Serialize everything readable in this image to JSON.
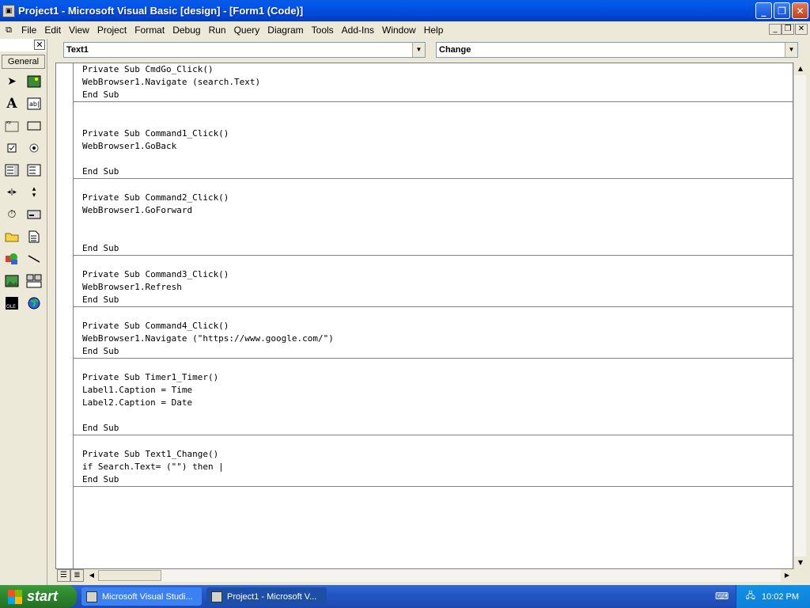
{
  "window": {
    "title": "Project1 - Microsoft Visual Basic [design] - [Form1 (Code)]"
  },
  "menu": [
    "File",
    "Edit",
    "View",
    "Project",
    "Format",
    "Debug",
    "Run",
    "Query",
    "Diagram",
    "Tools",
    "Add-Ins",
    "Window",
    "Help"
  ],
  "toolbox": {
    "tab_label": "General",
    "tools": [
      "pointer-icon",
      "picturebox-icon",
      "label-icon",
      "textbox-icon",
      "frame-icon",
      "commandbutton-icon",
      "checkbox-icon",
      "optionbutton-icon",
      "combobox-icon",
      "listbox-icon",
      "hscrollbar-icon",
      "vscrollbar-icon",
      "timer-icon",
      "drivelistbox-icon",
      "dirlistbox-icon",
      "filelistbox-icon",
      "shape-icon",
      "line-icon",
      "image-icon",
      "data-icon",
      "ole-icon",
      "webbrowser-icon"
    ]
  },
  "code_window": {
    "object_combo": "Text1",
    "procedure_combo": "Change",
    "procedures": [
      {
        "lines": [
          "Private Sub CmdGo_Click()",
          "WebBrowser1.Navigate (search.Text)",
          "End Sub"
        ]
      },
      {
        "lines": [
          "",
          "",
          "Private Sub Command1_Click()",
          "WebBrowser1.GoBack",
          "",
          "End Sub"
        ]
      },
      {
        "lines": [
          "",
          "Private Sub Command2_Click()",
          "WebBrowser1.GoForward",
          "",
          "",
          "End Sub"
        ]
      },
      {
        "lines": [
          "",
          "Private Sub Command3_Click()",
          "WebBrowser1.Refresh",
          "End Sub"
        ]
      },
      {
        "lines": [
          "",
          "Private Sub Command4_Click()",
          "WebBrowser1.Navigate (\"https://www.google.com/\")",
          "End Sub"
        ]
      },
      {
        "lines": [
          "",
          "Private Sub Timer1_Timer()",
          "Label1.Caption = Time",
          "Label2.Caption = Date",
          "",
          "End Sub"
        ]
      },
      {
        "lines": [
          "",
          "Private Sub Text1_Change()",
          "if Search.Text= (\"\") then |",
          "End Sub"
        ]
      }
    ]
  },
  "taskbar": {
    "start_label": "start",
    "tasks": [
      "Microsoft Visual Studi...",
      "Project1 - Microsoft V..."
    ],
    "clock": "10:02 PM"
  },
  "colors": {
    "titlebar": "#0058ee",
    "taskbar": "#2457c4",
    "start": "#2f8a2f"
  }
}
